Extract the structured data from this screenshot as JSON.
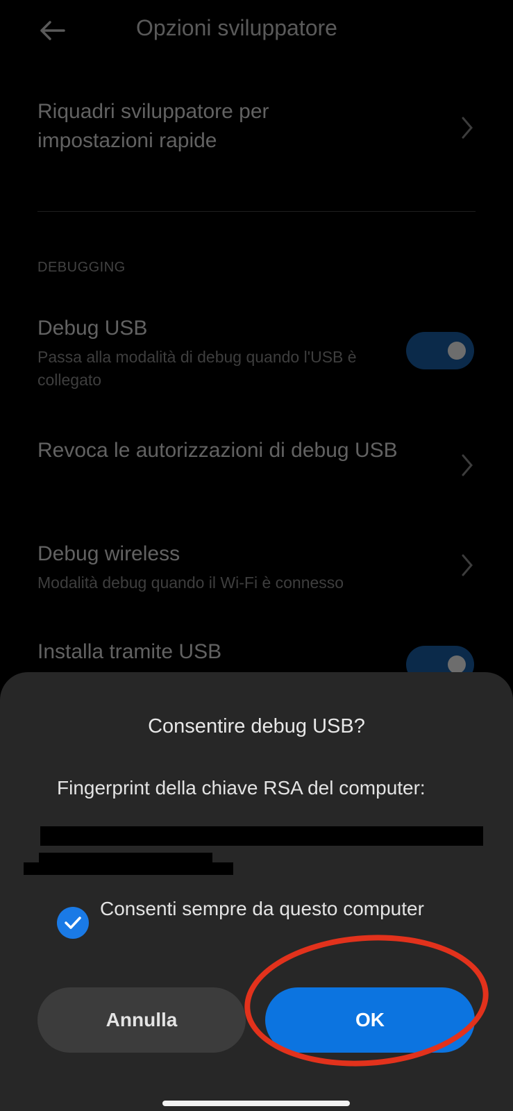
{
  "header": {
    "title": "Opzioni sviluppatore",
    "back_icon": "back-arrow-icon"
  },
  "settings": {
    "quick_tiles": {
      "title": "Riquadri sviluppatore per impostazioni rapide"
    },
    "section_label": "DEBUGGING",
    "debug_usb": {
      "title": "Debug USB",
      "subtitle": "Passa alla modalità di debug quando l'USB è collegato",
      "enabled": true
    },
    "revoke": {
      "title": "Revoca le autorizzazioni di debug USB"
    },
    "wireless": {
      "title": "Debug wireless",
      "subtitle": "Modalità debug quando il Wi-Fi è connesso"
    },
    "install_usb": {
      "title": "Installa tramite USB",
      "enabled": true
    }
  },
  "dialog": {
    "title": "Consentire debug USB?",
    "body": "Fingerprint della chiave RSA del computer:",
    "always_allow_label": "Consenti sempre da questo computer",
    "always_allow_checked": true,
    "cancel_label": "Annulla",
    "ok_label": "OK"
  },
  "colors": {
    "accent": "#0c74e0",
    "annotation": "#e2321c"
  }
}
